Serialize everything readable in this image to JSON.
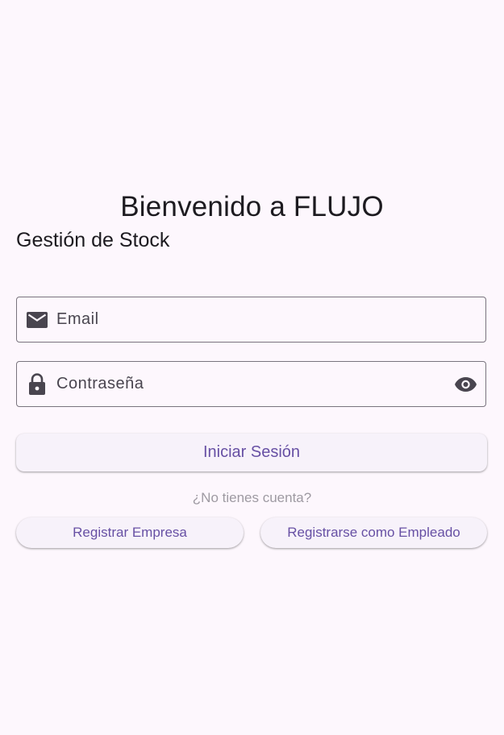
{
  "header": {
    "title": "Bienvenido a FLUJO",
    "subtitle": "Gestión de Stock"
  },
  "form": {
    "email": {
      "label": "Email",
      "icon": "mail-icon"
    },
    "password": {
      "label": "Contraseña",
      "icon": "lock-icon",
      "toggle_icon": "eye-icon"
    },
    "login_label": "Iniciar Sesión"
  },
  "register": {
    "hint": "¿No tienes cuenta?",
    "company_label": "Registrar Empresa",
    "employee_label": "Registrarse como Empleado"
  },
  "colors": {
    "background": "#fdf7fd",
    "accent": "#6750a4",
    "button_bg": "#f7f2fa",
    "outline": "#79747e",
    "icon": "#49454f"
  }
}
